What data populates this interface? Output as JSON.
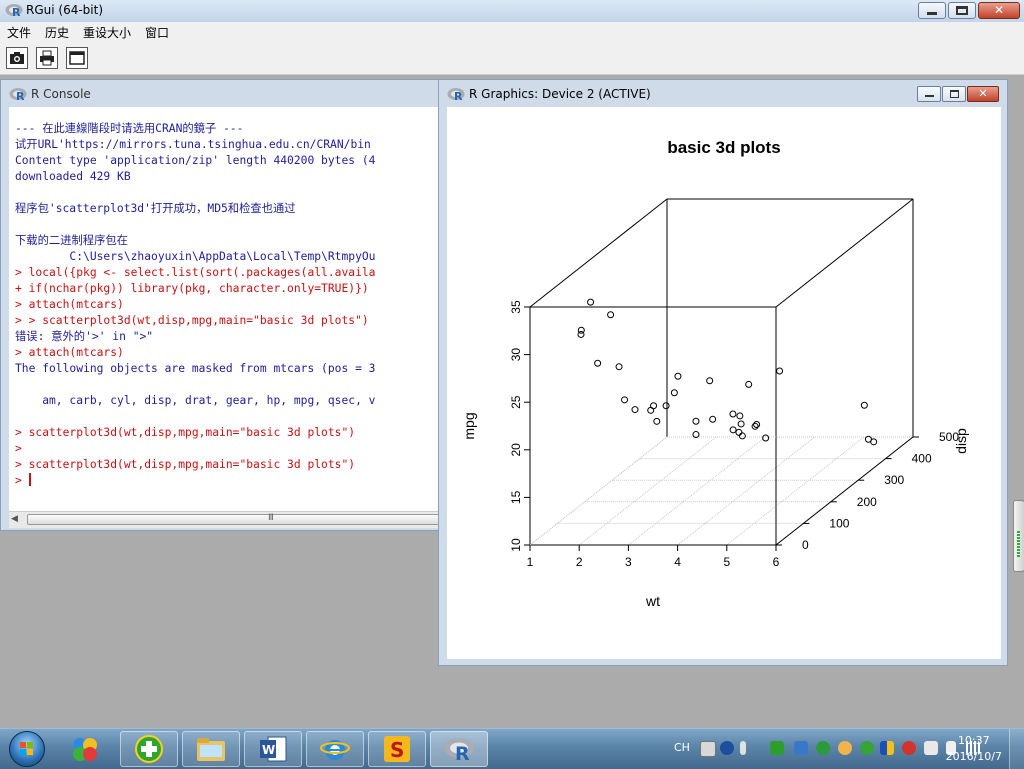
{
  "app": {
    "title": "RGui (64-bit)",
    "menu": [
      "文件",
      "历史",
      "重设大小",
      "窗口"
    ],
    "toolbar_icons": [
      "camera-icon",
      "printer-icon",
      "console-window-icon"
    ]
  },
  "console": {
    "title": "R Console",
    "lines": [
      {
        "text": "--- 在此連線階段时请选用CRAN的鏡子 ---",
        "kind": "out"
      },
      {
        "text": "试开URL'https://mirrors.tuna.tsinghua.edu.cn/CRAN/bin",
        "kind": "out"
      },
      {
        "text": "Content type 'application/zip' length 440200 bytes (4",
        "kind": "out"
      },
      {
        "text": "downloaded 429 KB",
        "kind": "out"
      },
      {
        "text": "",
        "kind": "out"
      },
      {
        "text": "程序包'scatterplot3d'打开成功，MD5和检查也通过",
        "kind": "out"
      },
      {
        "text": "",
        "kind": "out"
      },
      {
        "text": "下载的二进制程序包在",
        "kind": "out"
      },
      {
        "text": "        C:\\Users\\zhaoyuxin\\AppData\\Local\\Temp\\RtmpyOu",
        "kind": "out"
      },
      {
        "text": "> local({pkg <- select.list(sort(.packages(all.availa",
        "kind": "in"
      },
      {
        "text": "+ if(nchar(pkg)) library(pkg, character.only=TRUE)})",
        "kind": "in"
      },
      {
        "text": "> attach(mtcars)",
        "kind": "in"
      },
      {
        "text": "> > scatterplot3d(wt,disp,mpg,main=\"basic 3d plots\")",
        "kind": "in"
      },
      {
        "text": "错误: 意外的'>' in \">\"",
        "kind": "out"
      },
      {
        "text": "> attach(mtcars)",
        "kind": "in"
      },
      {
        "text": "The following objects are masked from mtcars (pos = 3",
        "kind": "out"
      },
      {
        "text": "",
        "kind": "out"
      },
      {
        "text": "    am, carb, cyl, disp, drat, gear, hp, mpg, qsec, v",
        "kind": "out"
      },
      {
        "text": "",
        "kind": "out"
      },
      {
        "text": "> scatterplot3d(wt,disp,mpg,main=\"basic 3d plots\")",
        "kind": "in"
      },
      {
        "text": ">",
        "kind": "in"
      },
      {
        "text": "> scatterplot3d(wt,disp,mpg,main=\"basic 3d plots\")",
        "kind": "in"
      },
      {
        "text": "> ",
        "kind": "in",
        "cursor": true
      }
    ],
    "scroll_grip": "III"
  },
  "graphics": {
    "title": "R Graphics: Device 2 (ACTIVE)"
  },
  "chart_data": {
    "type": "scatter",
    "title": "basic 3d plots",
    "xlabel": "wt",
    "ylabel": "disp",
    "zlabel": "mpg",
    "xlim": [
      1,
      6
    ],
    "ylim": [
      0,
      500
    ],
    "zlim": [
      10,
      35
    ],
    "x_ticks": [
      "1",
      "2",
      "3",
      "4",
      "5",
      "6"
    ],
    "y_ticks": [
      "0",
      "100",
      "200",
      "300",
      "400",
      "500"
    ],
    "z_ticks": [
      "10",
      "15",
      "20",
      "25",
      "30",
      "35"
    ],
    "points": [
      {
        "wt": 2.62,
        "disp": 160.0,
        "mpg": 21.0
      },
      {
        "wt": 2.875,
        "disp": 160.0,
        "mpg": 21.0
      },
      {
        "wt": 2.32,
        "disp": 108.0,
        "mpg": 22.8
      },
      {
        "wt": 3.215,
        "disp": 258.0,
        "mpg": 21.4
      },
      {
        "wt": 3.44,
        "disp": 360.0,
        "mpg": 18.7
      },
      {
        "wt": 3.46,
        "disp": 225.0,
        "mpg": 18.1
      },
      {
        "wt": 3.57,
        "disp": 360.0,
        "mpg": 14.3
      },
      {
        "wt": 3.19,
        "disp": 146.7,
        "mpg": 24.4
      },
      {
        "wt": 3.15,
        "disp": 140.8,
        "mpg": 22.8
      },
      {
        "wt": 3.44,
        "disp": 167.6,
        "mpg": 19.2
      },
      {
        "wt": 3.44,
        "disp": 167.6,
        "mpg": 17.8
      },
      {
        "wt": 4.07,
        "disp": 275.8,
        "mpg": 16.4
      },
      {
        "wt": 3.73,
        "disp": 275.8,
        "mpg": 17.3
      },
      {
        "wt": 3.78,
        "disp": 275.8,
        "mpg": 15.2
      },
      {
        "wt": 5.25,
        "disp": 472.0,
        "mpg": 10.4
      },
      {
        "wt": 5.424,
        "disp": 460.0,
        "mpg": 10.4
      },
      {
        "wt": 5.345,
        "disp": 440.0,
        "mpg": 14.7
      },
      {
        "wt": 2.2,
        "disp": 78.7,
        "mpg": 32.4
      },
      {
        "wt": 1.615,
        "disp": 75.7,
        "mpg": 30.4
      },
      {
        "wt": 1.835,
        "disp": 71.1,
        "mpg": 33.9
      },
      {
        "wt": 2.465,
        "disp": 120.1,
        "mpg": 21.5
      },
      {
        "wt": 3.52,
        "disp": 318.0,
        "mpg": 15.5
      },
      {
        "wt": 3.435,
        "disp": 304.0,
        "mpg": 15.2
      },
      {
        "wt": 3.84,
        "disp": 350.0,
        "mpg": 13.3
      },
      {
        "wt": 3.845,
        "disp": 400.0,
        "mpg": 19.2
      },
      {
        "wt": 1.935,
        "disp": 79.0,
        "mpg": 27.3
      },
      {
        "wt": 2.14,
        "disp": 120.3,
        "mpg": 26.0
      },
      {
        "wt": 1.513,
        "disp": 95.1,
        "mpg": 30.4
      },
      {
        "wt": 3.17,
        "disp": 351.0,
        "mpg": 15.8
      },
      {
        "wt": 2.77,
        "disp": 145.0,
        "mpg": 19.7
      },
      {
        "wt": 3.57,
        "disp": 301.0,
        "mpg": 15.0
      },
      {
        "wt": 2.78,
        "disp": 121.0,
        "mpg": 21.4
      }
    ],
    "grid": true
  },
  "taskbar": {
    "apps": [
      "360-security-icon",
      "360-plus-icon",
      "file-explorer-icon",
      "word-icon",
      "internet-explorer-icon",
      "sogou-icon",
      "r-icon"
    ],
    "ime": "CH",
    "time": "10:37",
    "date": "2016/10/7"
  },
  "colors": {
    "console_output": "#1e1e9c",
    "console_input": "#cc1111"
  }
}
